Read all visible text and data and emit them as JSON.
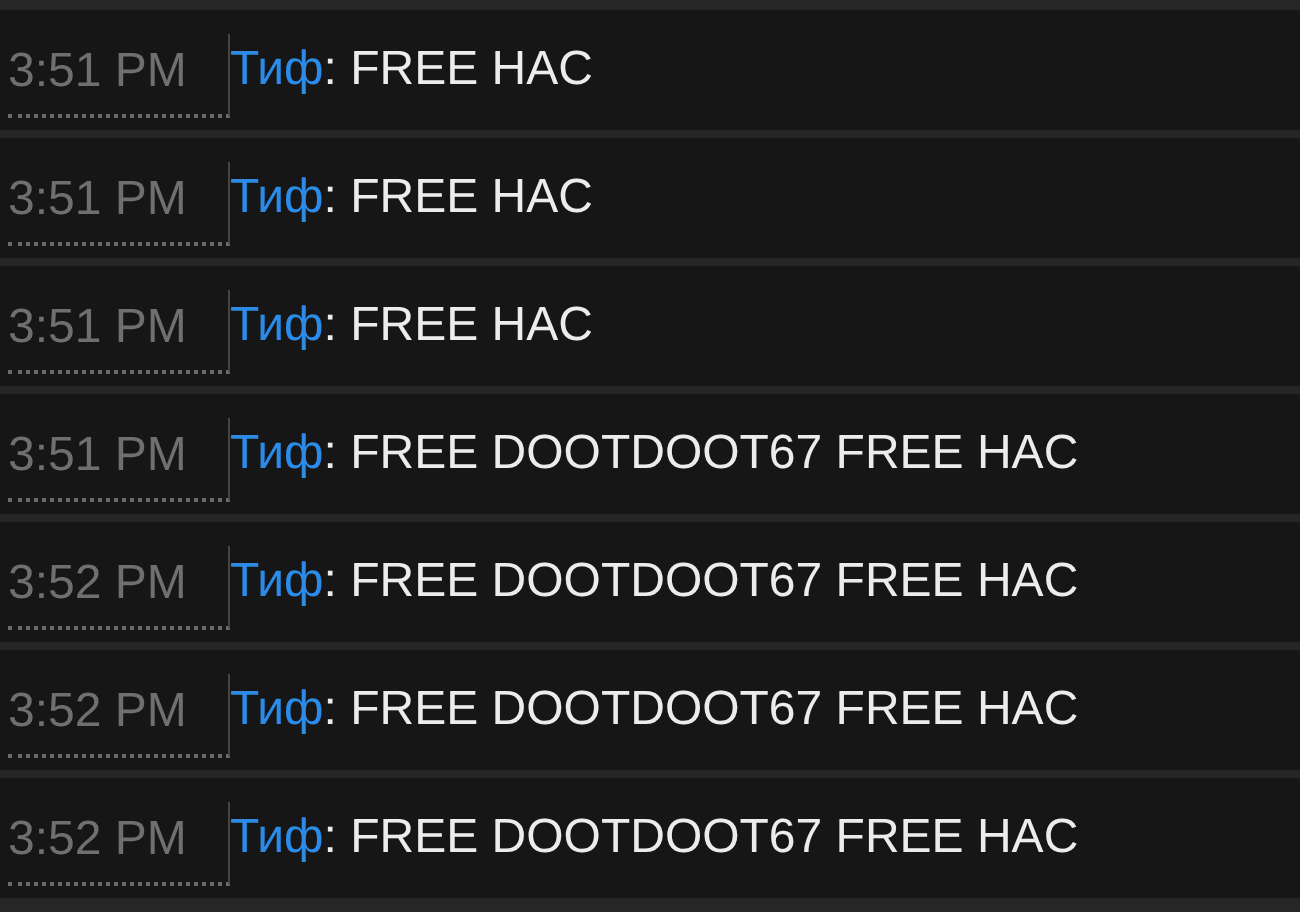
{
  "messages": [
    {
      "time": "3:51 PM",
      "user": "Тиф",
      "text": ": FREE HAC"
    },
    {
      "time": "3:51 PM",
      "user": "Тиф",
      "text": ": FREE HAC"
    },
    {
      "time": "3:51 PM",
      "user": "Тиф",
      "text": ": FREE HAC"
    },
    {
      "time": "3:51 PM",
      "user": "Тиф",
      "text": ": FREE DOOTDOOT67 FREE HAC"
    },
    {
      "time": "3:52 PM",
      "user": "Тиф",
      "text": ": FREE DOOTDOOT67 FREE HAC"
    },
    {
      "time": "3:52 PM",
      "user": "Тиф",
      "text": ": FREE DOOTDOOT67 FREE HAC"
    },
    {
      "time": "3:52 PM",
      "user": "Тиф",
      "text": ": FREE DOOTDOOT67 FREE HAC"
    }
  ]
}
